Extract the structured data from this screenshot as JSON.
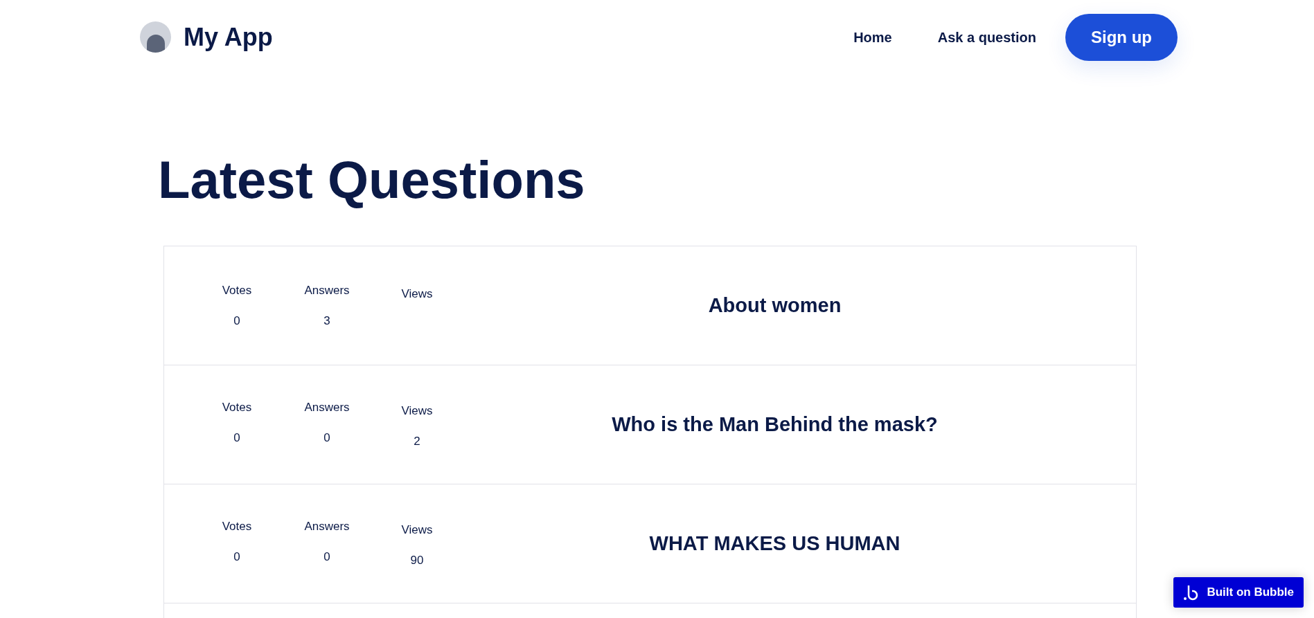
{
  "header": {
    "app_name": "My App",
    "nav": [
      "Home",
      "Ask a question"
    ],
    "signup": "Sign up"
  },
  "heading": "Latest Questions",
  "questions": [
    {
      "votes_label": "Votes",
      "votes": "0",
      "answers_label": "Answers",
      "answers": "3",
      "views_label": "Views",
      "title": "About women"
    },
    {
      "votes_label": "Votes",
      "votes": "0",
      "answers_label": "Answers",
      "answers": "0",
      "views_label": "Views",
      "views": "2",
      "title": "Who is the Man Behind the mask?"
    },
    {
      "votes_label": "Votes",
      "votes": "0",
      "answers_label": "Answers",
      "answers": "0",
      "views_label": "Views",
      "views": "90",
      "title": "WHAT MAKES US HUMAN"
    }
  ],
  "badge": "Built on Bubble"
}
